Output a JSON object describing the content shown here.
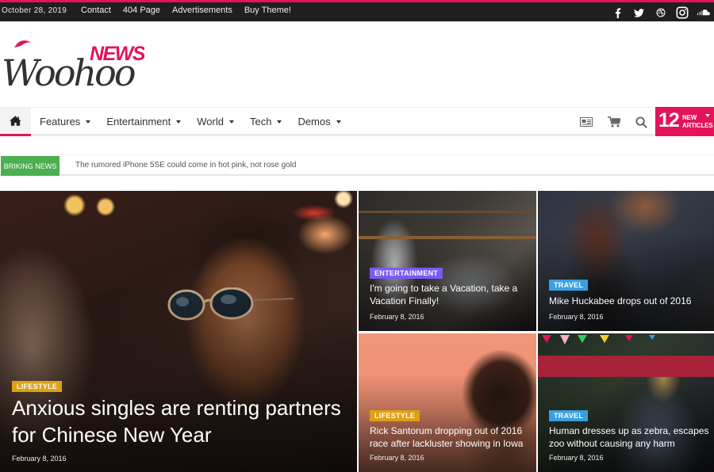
{
  "topbar": {
    "date": "October 28, 2019",
    "links": [
      "Contact",
      "404 Page",
      "Advertisements",
      "Buy Theme!"
    ],
    "social_icons": [
      "facebook-icon",
      "twitter-icon",
      "dribbble-icon",
      "instagram-icon",
      "soundcloud-icon"
    ]
  },
  "logo": {
    "script_text": "Woohoo",
    "accent_text": "NEWS"
  },
  "nav": {
    "home_icon": "home-icon",
    "items": [
      {
        "label": "Features"
      },
      {
        "label": "Entertainment"
      },
      {
        "label": "World"
      },
      {
        "label": "Tech"
      },
      {
        "label": "Demos"
      }
    ],
    "tools": [
      "newspaper-icon",
      "cart-icon",
      "search-icon"
    ],
    "new_articles": {
      "count": "12",
      "line1": "NEW",
      "line2": "ARTICLES"
    }
  },
  "ticker": {
    "label": "BRIKING NEWS",
    "headline": "The rumored iPhone 5SE could come in hot pink, not rose gold"
  },
  "colors": {
    "accent": "#e3145a",
    "ticker_badge": "#4caf50",
    "lifestyle": "#e0a014",
    "entertainment": "#7a5af5",
    "travel": "#3a9fe0"
  },
  "featured": [
    {
      "category": "LIFESTYLE",
      "title": "Anxious singles are renting partners for Chinese New Year",
      "date": "February 8, 2016"
    },
    {
      "category": "ENTERTAINMENT",
      "title": "I'm going to take a Vacation, take a Vacation Finally!",
      "date": "February 8, 2016"
    },
    {
      "category": "TRAVEL",
      "title": "Mike Huckabee drops out of 2016",
      "date": "February 8, 2016"
    },
    {
      "category": "LIFESTYLE",
      "title": "Rick Santorum dropping out of 2016 race after lackluster showing in Iowa",
      "date": "February 8, 2016"
    },
    {
      "category": "TRAVEL",
      "title": "Human dresses up as zebra, escapes zoo without causing any harm",
      "date": "February 8, 2016"
    }
  ]
}
